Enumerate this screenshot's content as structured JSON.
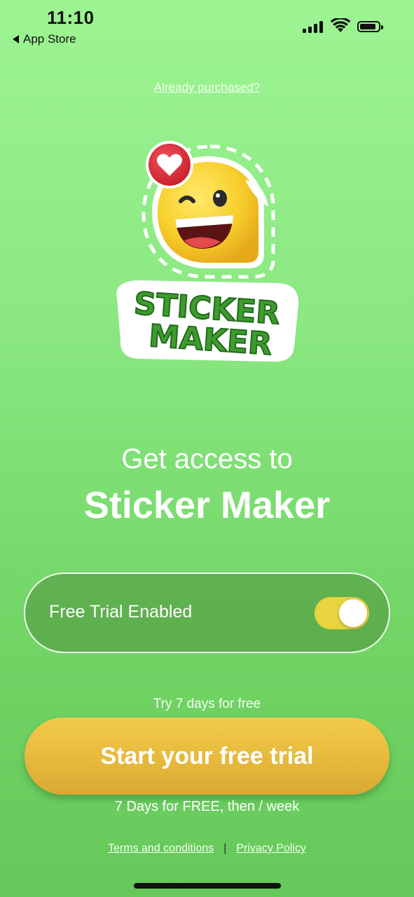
{
  "status_bar": {
    "time": "11:10",
    "back_label": "App Store",
    "icons": [
      "cellular-signal-icon",
      "wifi-icon",
      "battery-icon"
    ]
  },
  "top_link": "Already purchased?",
  "logo": {
    "line1": "STICKER",
    "line2": "MAKER"
  },
  "headline": {
    "line1": "Get access to",
    "line2": "Sticker Maker"
  },
  "trial_toggle": {
    "label": "Free Trial Enabled",
    "enabled": true
  },
  "try_text": "Try 7 days for free",
  "cta_label": "Start your free trial",
  "price_text": "7 Days for FREE, then  / week",
  "legal": {
    "terms": "Terms and conditions",
    "separator": "|",
    "privacy": "Privacy Policy"
  },
  "colors": {
    "background_top": "#9df493",
    "background_bottom": "#66c85a",
    "cta": "#e6b93d",
    "toggle_on": "#e9d33f",
    "logo_text": "#3f9b2f"
  }
}
